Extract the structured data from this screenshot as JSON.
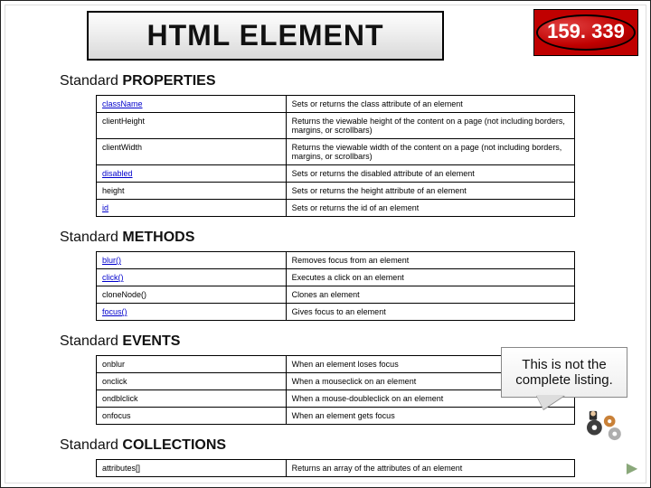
{
  "title": "HTML ELEMENT",
  "page_number": "159. 339",
  "sections": [
    {
      "heading_prefix": "Standard ",
      "heading_bold": "PROPERTIES",
      "rows": [
        {
          "name": "className",
          "link": true,
          "desc": "Sets or returns the class attribute of an element"
        },
        {
          "name": "clientHeight",
          "link": false,
          "desc": "Returns the viewable height of the content on a page (not including borders, margins, or scrollbars)"
        },
        {
          "name": "clientWidth",
          "link": false,
          "desc": "Returns the viewable width of the content on a page (not including borders, margins, or scrollbars)"
        },
        {
          "name": "disabled",
          "link": true,
          "desc": "Sets or returns the disabled attribute of an element"
        },
        {
          "name": "height",
          "link": false,
          "desc": "Sets or returns the height attribute of an element"
        },
        {
          "name": "id",
          "link": true,
          "desc": "Sets or returns the id of an element"
        }
      ]
    },
    {
      "heading_prefix": "Standard ",
      "heading_bold": "METHODS",
      "rows": [
        {
          "name": "blur()",
          "link": true,
          "desc": "Removes focus from an element"
        },
        {
          "name": "click()",
          "link": true,
          "desc": "Executes a click on an element"
        },
        {
          "name": "cloneNode()",
          "link": false,
          "desc": "Clones an element"
        },
        {
          "name": "focus()",
          "link": true,
          "desc": "Gives focus to an element"
        }
      ]
    },
    {
      "heading_prefix": "Standard ",
      "heading_bold": "EVENTS",
      "rows": [
        {
          "name": "onblur",
          "link": false,
          "desc": "When an element loses focus"
        },
        {
          "name": "onclick",
          "link": false,
          "desc": "When a mouseclick on an element"
        },
        {
          "name": "ondblclick",
          "link": false,
          "desc": "When a mouse-doubleclick on an element"
        },
        {
          "name": "onfocus",
          "link": false,
          "desc": "When an element gets focus"
        }
      ]
    },
    {
      "heading_prefix": "Standard ",
      "heading_bold": "COLLECTIONS",
      "rows": [
        {
          "name": "attributes[]",
          "link": false,
          "desc": "Returns an array of the attributes of an element"
        }
      ]
    }
  ],
  "callout": "This is not the complete listing."
}
